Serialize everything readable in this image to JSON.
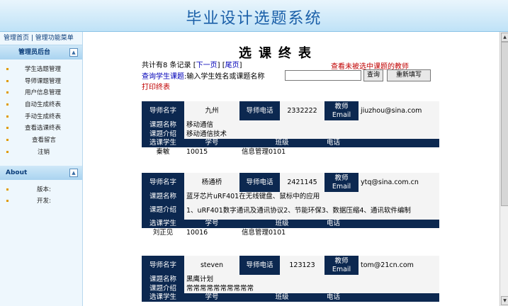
{
  "app": {
    "title": "毕业设计选题系统"
  },
  "sidebar": {
    "top_links": [
      "管理首页",
      "管理功能菜单"
    ],
    "admin_section": "管理员后台",
    "menu": [
      "学生选题管理",
      "导师课题管理",
      "用户信息管理",
      "自动生成终表",
      "手动生成终表",
      "查看选课终表",
      "查看留言",
      "注销"
    ],
    "about_section": "About",
    "about_items": [
      "版本:",
      "开发:"
    ]
  },
  "main": {
    "page_title": "选课终表",
    "summary": {
      "prefix": "共计有8 条记录",
      "next": "下一页",
      "last": "尾页"
    },
    "unselected_link": "查看未被选中课题的教师",
    "search": {
      "link": "查询学生课题",
      "label": ":输入学生姓名或课题名称",
      "value": "",
      "query_btn": "查询",
      "reset_btn": "重新填写"
    },
    "print_link": "打印终表",
    "labels": {
      "teacher": "导师名字",
      "phone": "导师电话",
      "email": "教师Email",
      "topic_name": "课题名称",
      "topic_intro": "课题介绍",
      "student": "选课学生",
      "student_id": "学号",
      "class": "班级",
      "student_phone": "电话"
    },
    "records": [
      {
        "teacher": "九州",
        "phone": "2332222",
        "email": "jiuzhou@sina.com",
        "topic": "移动通信",
        "intro": "移动通信技术",
        "student": "秦敏",
        "student_id": "10015",
        "class": "信息管理0101",
        "student_phone": ""
      },
      {
        "teacher": "杨通桥",
        "phone": "2421145",
        "email": "ytq@sina.com.cn",
        "topic": "蓝牙芯片uRF401在无线键盘、鼠标中的应用",
        "intro": "1、uRF401数字通讯及通讯协议2、节能环保3、数据压缩4、通讯软件编制",
        "student": "刘正见",
        "student_id": "10016",
        "class": "信息管理0101",
        "student_phone": ""
      },
      {
        "teacher": "steven",
        "phone": "123123",
        "email": "tom@21cn.com",
        "topic": "黑鹰计划",
        "intro": "常常常常常常常常常常",
        "student": "",
        "student_id": "",
        "class": "",
        "student_phone": ""
      }
    ]
  },
  "colors": {
    "header_cell": "#0c2850",
    "banner_title": "#1a5fa8",
    "alert_text": "#c00000",
    "link": "#0000b8"
  }
}
